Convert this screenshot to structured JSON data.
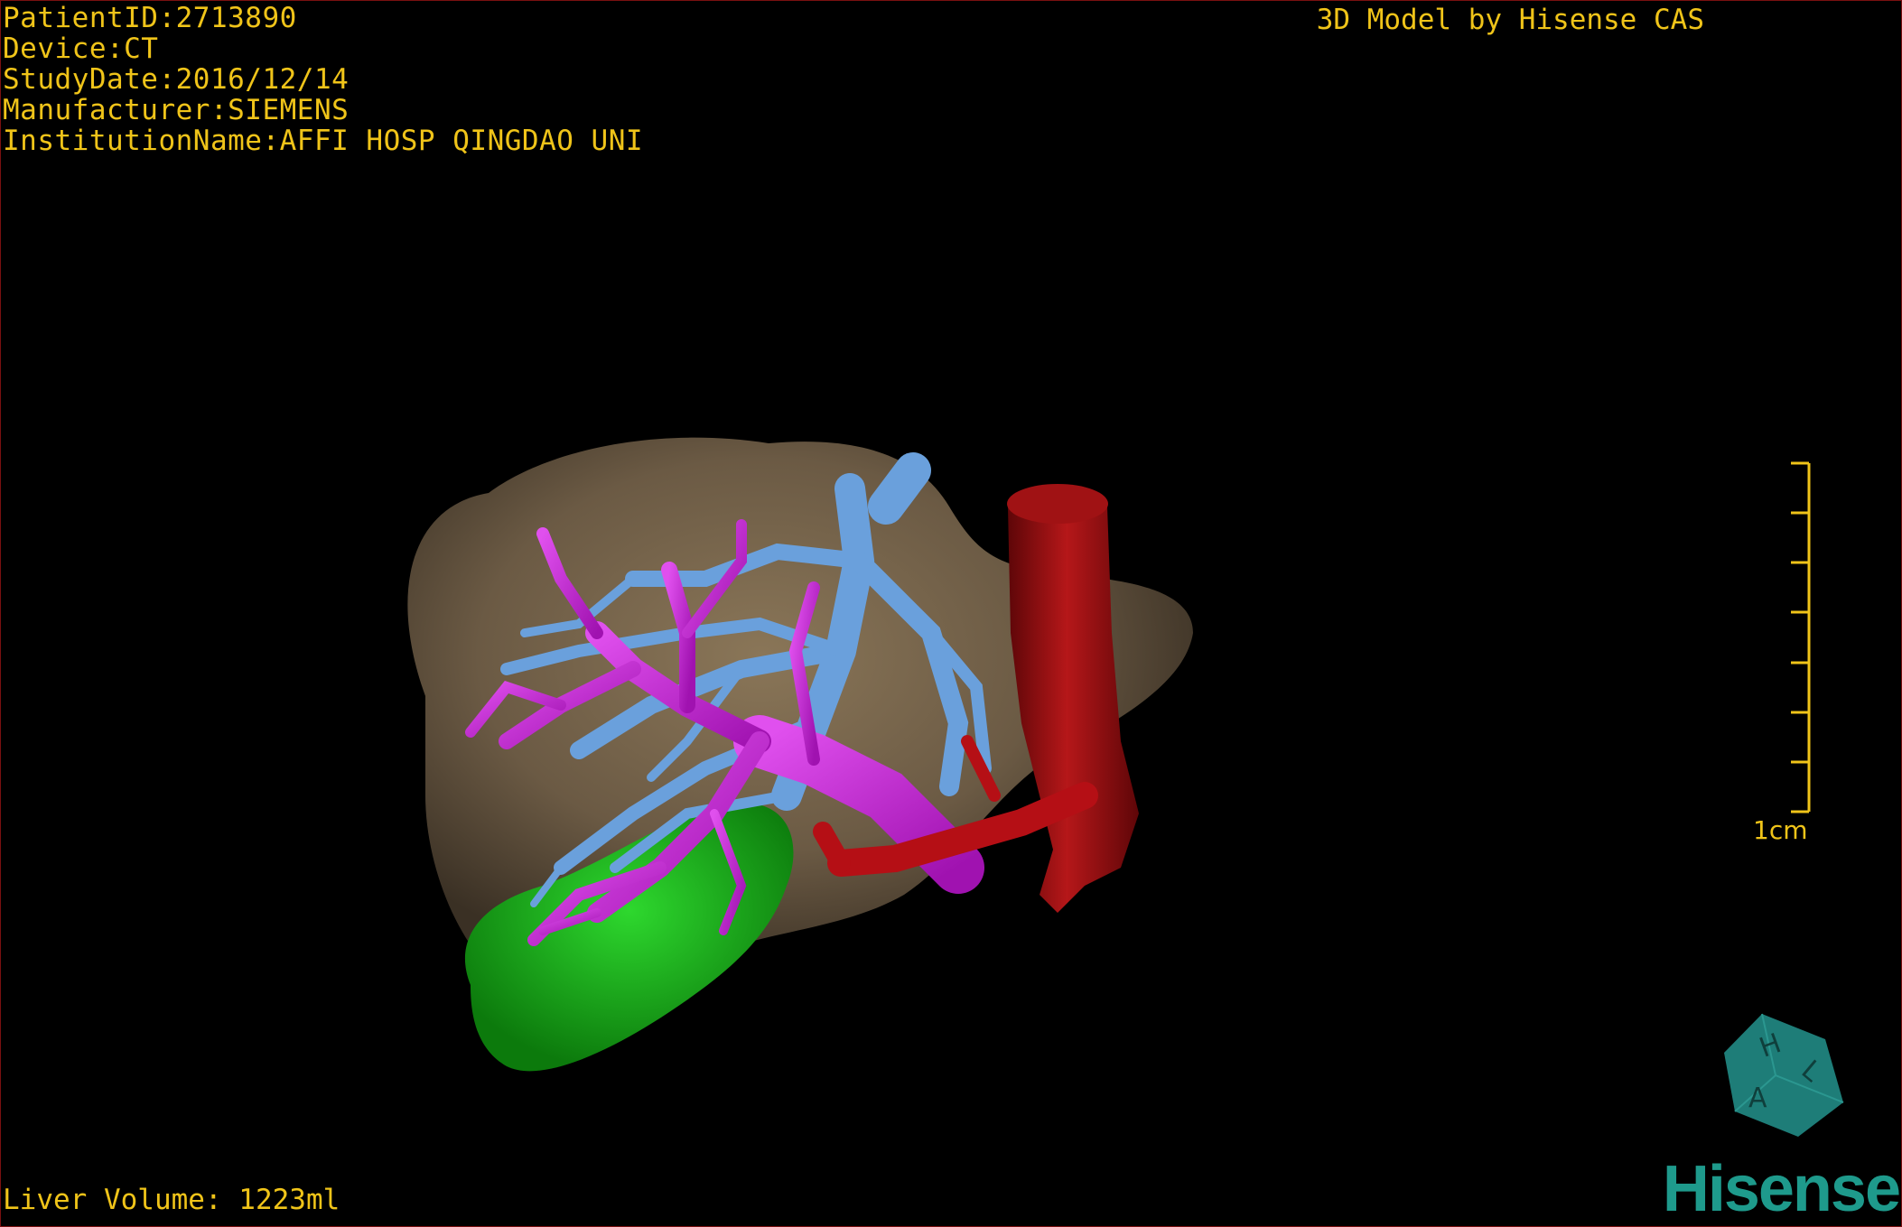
{
  "header": {
    "patient_id": "PatientID:2713890",
    "device": "Device:CT",
    "study_date": "StudyDate:2016/12/14",
    "manufacturer": "Manufacturer:SIEMENS",
    "institution": "InstitutionName:AFFI HOSP QINGDAO UNI"
  },
  "title": "3D Model by Hisense CAS",
  "footer": {
    "liver_volume": "Liver Volume: 1223ml"
  },
  "scale_bar": {
    "label": "1cm",
    "color": "#f0c419"
  },
  "orientation_cube": {
    "letters": [
      "H",
      "A",
      "L"
    ],
    "color": "#1e7d78"
  },
  "brand": {
    "logo_text": "Hisense",
    "color": "#1e9a8c"
  },
  "model": {
    "structures": [
      {
        "name": "liver",
        "color": "#6b5a44"
      },
      {
        "name": "hepatic-veins",
        "color": "#6aa0dc"
      },
      {
        "name": "portal-veins",
        "color": "#c41ed0"
      },
      {
        "name": "gallbladder",
        "color": "#16b516"
      },
      {
        "name": "inferior-vena-cava",
        "color": "#9a0f10"
      },
      {
        "name": "hepatic-artery",
        "color": "#b50f15"
      }
    ]
  }
}
